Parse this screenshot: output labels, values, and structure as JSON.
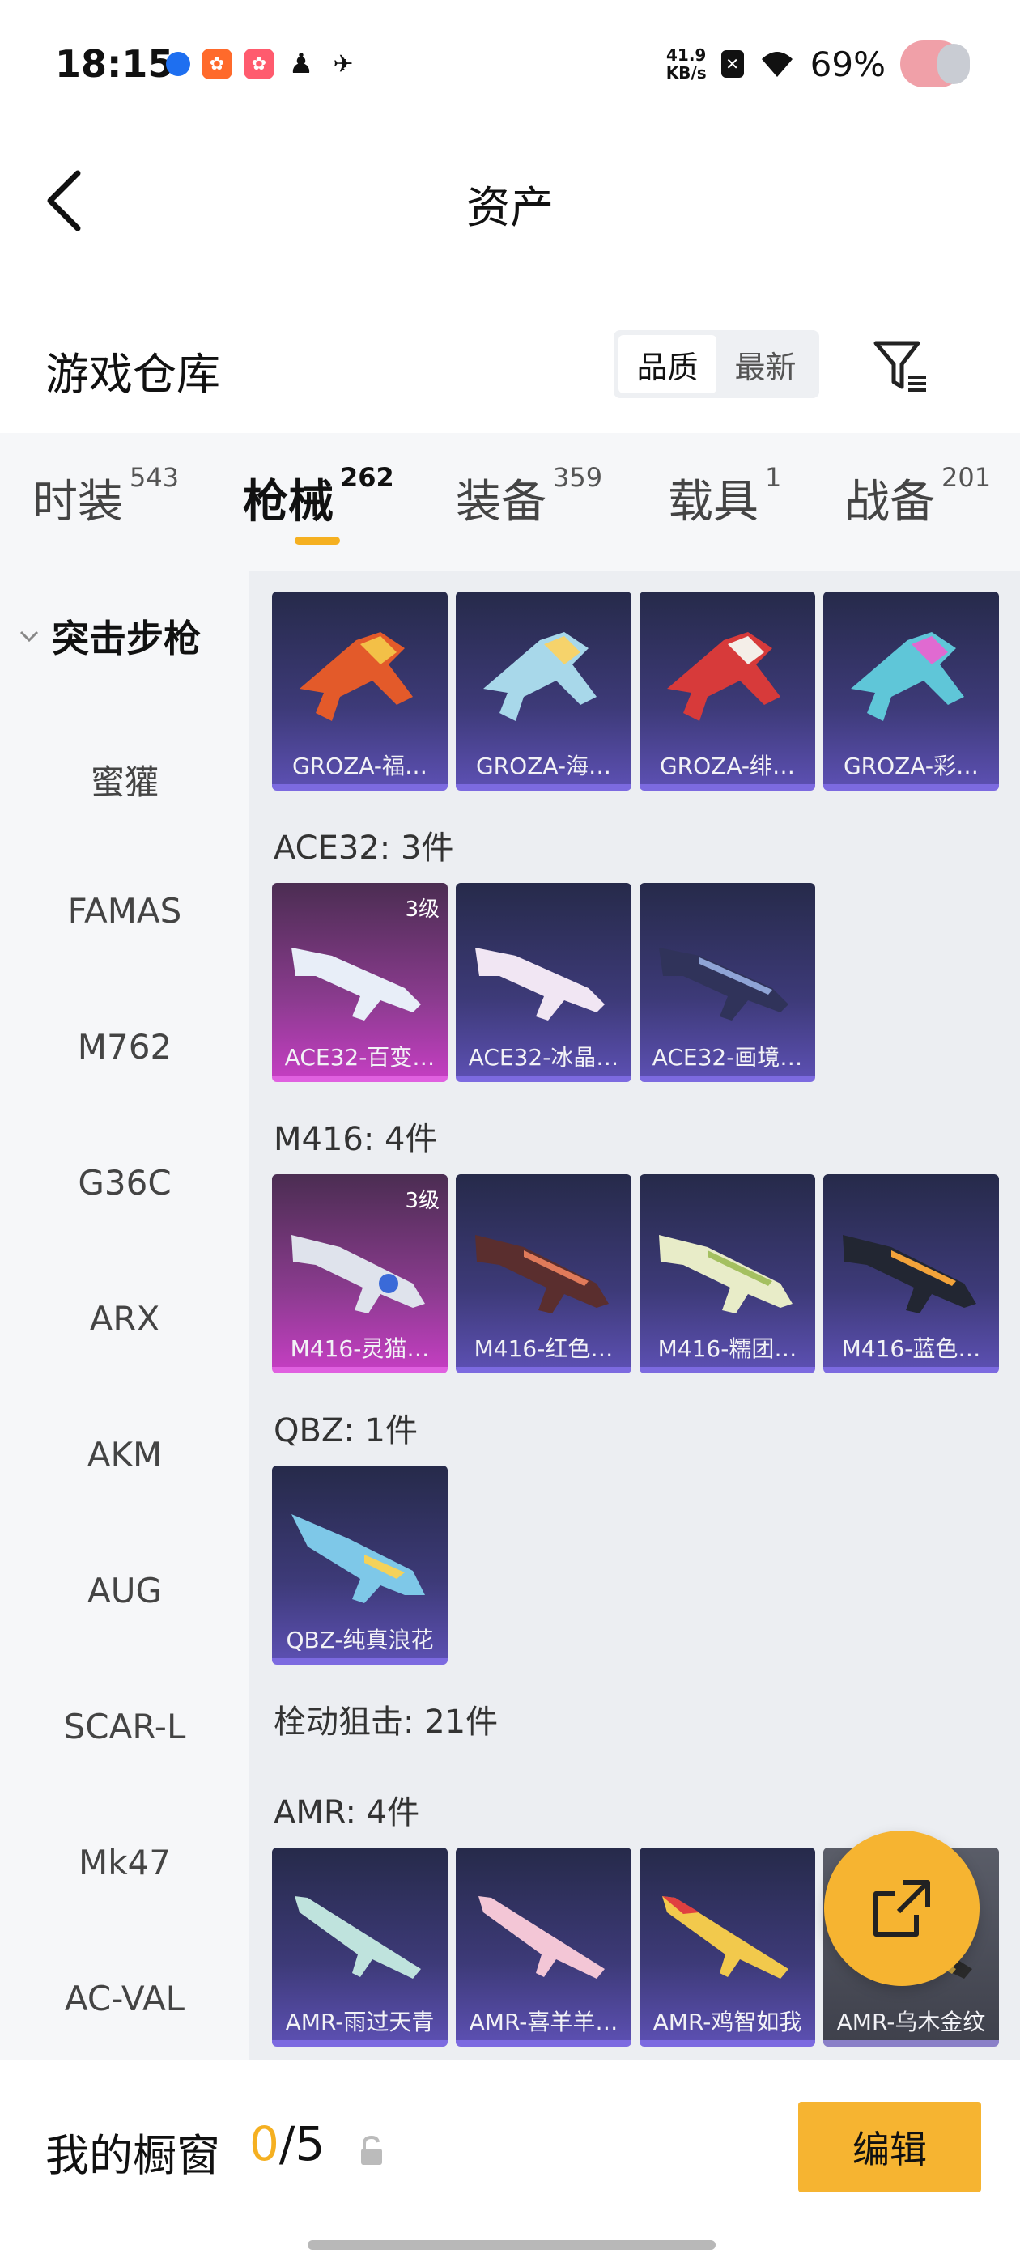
{
  "status_bar": {
    "time": "18:15",
    "net_speed_value": "41.9",
    "net_speed_unit": "KB/s",
    "battery": "69%"
  },
  "header": {
    "title": "资产"
  },
  "warehouse": {
    "title": "游戏仓库",
    "sort_options": [
      "品质",
      "最新"
    ],
    "active_sort": "品质"
  },
  "tabs": [
    {
      "label": "时装",
      "count": "543"
    },
    {
      "label": "枪械",
      "count": "262"
    },
    {
      "label": "装备",
      "count": "359"
    },
    {
      "label": "载具",
      "count": "1"
    },
    {
      "label": "战备",
      "count": "201"
    }
  ],
  "active_tab": "枪械",
  "sidebar": {
    "category": "突击步枪",
    "items": [
      "蜜獾",
      "FAMAS",
      "M762",
      "G36C",
      "ARX",
      "AKM",
      "AUG",
      "SCAR-L",
      "Mk47",
      "AC-VAL"
    ]
  },
  "content": {
    "groza_items": [
      "GROZA-福…",
      "GROZA-海…",
      "GROZA-绯…",
      "GROZA-彩…"
    ],
    "ace32_label": "ACE32: 3件",
    "ace32_items": [
      "ACE32-百变…",
      "ACE32-冰晶…",
      "ACE32-画境…"
    ],
    "ace32_level": "3级",
    "m416_label": "M416: 4件",
    "m416_items": [
      "M416-灵猫…",
      "M416-红色…",
      "M416-糯团…",
      "M416-蓝色…"
    ],
    "m416_level": "3级",
    "qbz_label": "QBZ: 1件",
    "qbz_items": [
      "QBZ-纯真浪花"
    ],
    "sniper_label": "栓动狙击: 21件",
    "amr_label": "AMR: 4件",
    "amr_items": [
      "AMR-雨过天青",
      "AMR-喜羊羊…",
      "AMR-鸡智如我",
      "AMR-乌木金纹"
    ]
  },
  "bottom": {
    "window_label": "我的橱窗",
    "current": "0",
    "total": "/5",
    "edit_label": "编辑"
  },
  "colors": {
    "accent": "#f6b431",
    "rare_card": "#3d3a78",
    "epic_card": "#8a3b8e"
  }
}
